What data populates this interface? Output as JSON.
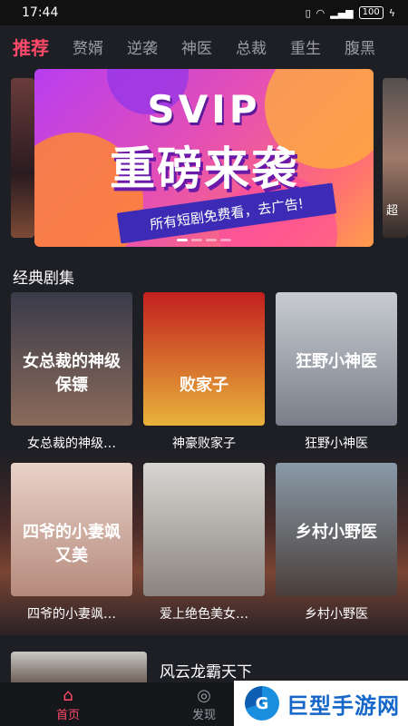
{
  "status": {
    "time": "17:44",
    "battery": "100"
  },
  "tabs": [
    {
      "label": "推荐",
      "active": true
    },
    {
      "label": "赘婿"
    },
    {
      "label": "逆袭"
    },
    {
      "label": "神医"
    },
    {
      "label": "总裁"
    },
    {
      "label": "重生"
    },
    {
      "label": "腹黑"
    }
  ],
  "banner": {
    "line1": "SVIP",
    "line2": "重磅来袭",
    "ribbon": "所有短剧免费看，去广告!",
    "side_right_text": "超"
  },
  "section": {
    "title": "经典剧集"
  },
  "dramas": [
    {
      "title": "女总裁的神级…",
      "poster_text": "女总裁的神级保镖",
      "bg": [
        "#3a3b4a",
        "#8a6a5a"
      ]
    },
    {
      "title": "神豪败家子",
      "poster_text": "败家子",
      "bg": [
        "#c21f1f",
        "#e8b23a"
      ]
    },
    {
      "title": "狂野小神医",
      "poster_text": "狂野小神医",
      "bg": [
        "#c8ccd2",
        "#7a7e88"
      ]
    },
    {
      "title": "四爷的小妻飒…",
      "poster_text": "四爷的小妻飒又美",
      "bg": [
        "#e9d2c8",
        "#b58a7c"
      ]
    },
    {
      "title": "爱上绝色美女…",
      "poster_text": "",
      "bg": [
        "#d8d6d2",
        "#8a8480"
      ]
    },
    {
      "title": "乡村小野医",
      "poster_text": "乡村小野医",
      "bg": [
        "#8a9aa8",
        "#4a3e3a"
      ]
    }
  ],
  "list": {
    "title": "风云龙霸天下"
  },
  "nav": [
    {
      "label": "首页",
      "icon": "home-icon",
      "active": true
    },
    {
      "label": "发现",
      "icon": "discover-icon"
    }
  ],
  "watermark": {
    "text": "巨型手游网"
  }
}
